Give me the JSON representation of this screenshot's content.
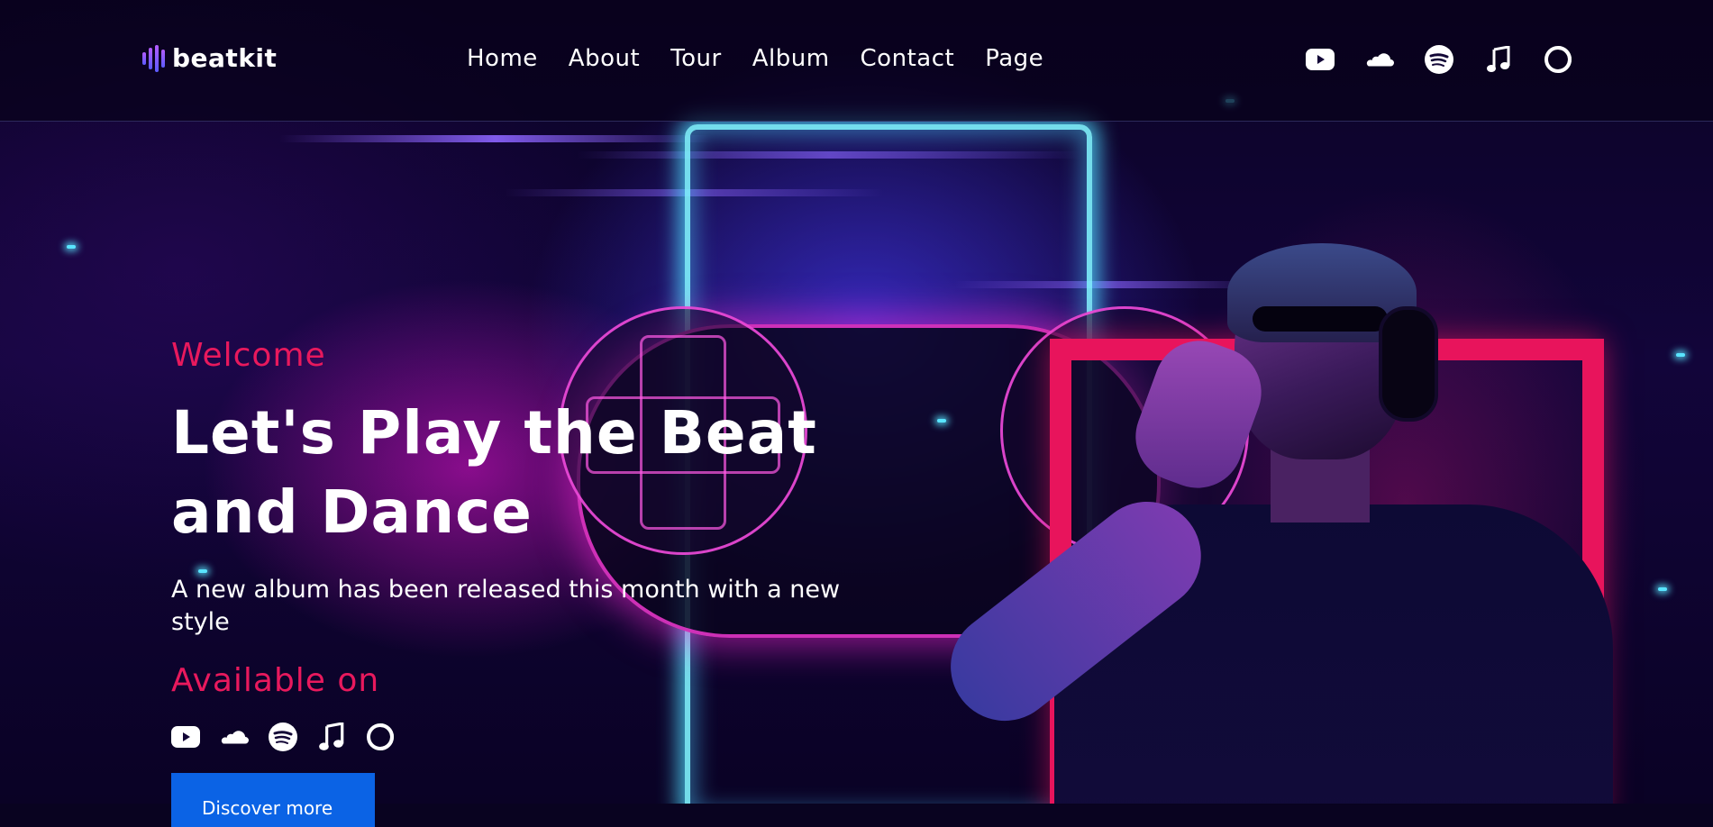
{
  "brand": {
    "name": "beatkit"
  },
  "nav": {
    "items": [
      {
        "label": "Home"
      },
      {
        "label": "About"
      },
      {
        "label": "Tour"
      },
      {
        "label": "Album"
      },
      {
        "label": "Contact"
      },
      {
        "label": "Page"
      }
    ]
  },
  "header_icons": [
    "youtube-icon",
    "soundcloud-icon",
    "spotify-icon",
    "itunes-icon",
    "amazon-music-icon"
  ],
  "hero": {
    "welcome": "Welcome",
    "headline_line1": "Let's Play the Beat",
    "headline_line2": "and Dance",
    "subtitle": "A new album has been released this month with a new style",
    "available_label": "Available on",
    "platform_icons": [
      "youtube-icon",
      "soundcloud-icon",
      "spotify-icon",
      "itunes-icon",
      "amazon-music-icon"
    ],
    "button_label": "Discover more"
  },
  "colors": {
    "accent_pink": "#e8195d",
    "button_blue": "#0b63e5",
    "background": "#090320",
    "neon_cyan": "#7ff4ff"
  }
}
